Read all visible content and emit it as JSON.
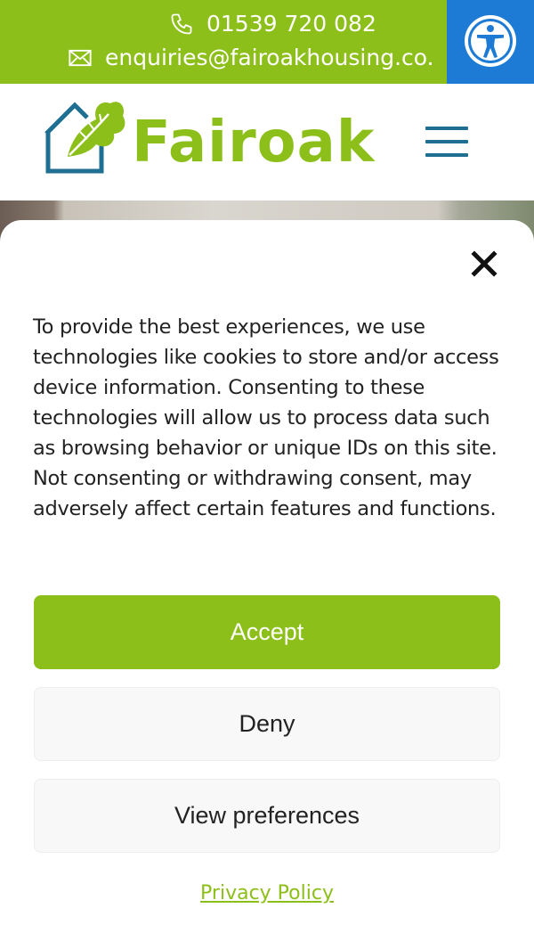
{
  "topbar": {
    "phone": "01539 720 082",
    "email": "enquiries@fairoakhousing.co.",
    "phone_icon": "phone-icon",
    "email_icon": "envelope-icon",
    "accessibility_icon": "accessibility-icon"
  },
  "header": {
    "logo_text": "Fairoak",
    "menu_icon": "hamburger-menu-icon"
  },
  "cookie_banner": {
    "close_icon": "close-icon",
    "text": "To provide the best experiences, we use technologies like cookies to store and/or access device information. Consenting to these technologies will allow us to process data such as browsing behavior or unique IDs on this site. Not consenting or withdrawing consent, may adversely affect certain features and functions.",
    "accept_label": "Accept",
    "deny_label": "Deny",
    "preferences_label": "View preferences",
    "privacy_link": "Privacy Policy"
  },
  "colors": {
    "brand_green": "#8cbf1a",
    "brand_blue": "#1f6f93",
    "accessibility_blue": "#1d7bd6"
  }
}
